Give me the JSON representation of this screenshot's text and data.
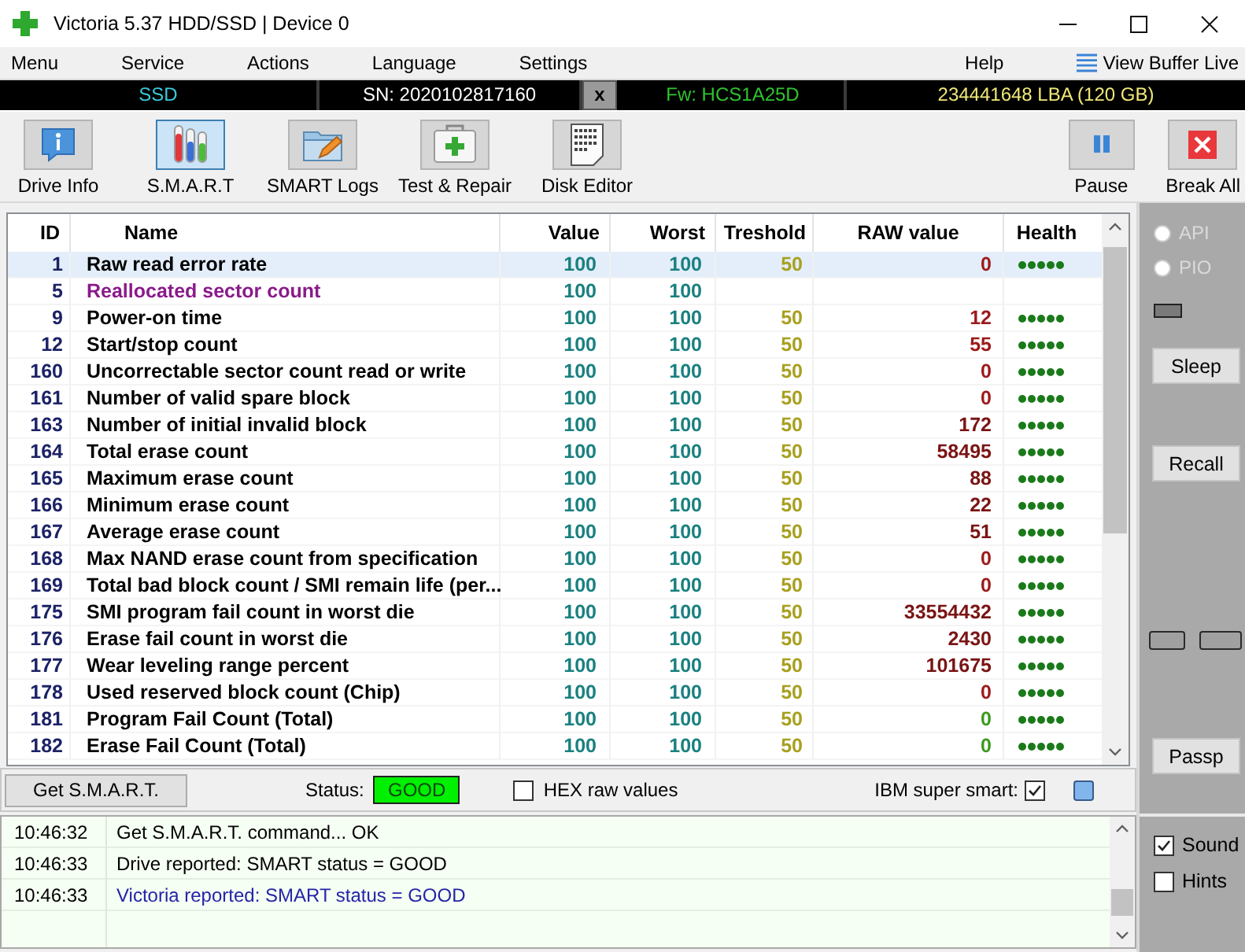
{
  "window": {
    "title": "Victoria 5.37 HDD/SSD | Device 0"
  },
  "menu": {
    "items": [
      "Menu",
      "Service",
      "Actions",
      "Language",
      "Settings"
    ],
    "help": "Help",
    "view_buffer": "View Buffer Live"
  },
  "info_bar": {
    "drive_type": "SSD",
    "serial": "SN: 2020102817160",
    "close": "x",
    "firmware": "Fw: HCS1A25D",
    "capacity": "234441648 LBA (120 GB)"
  },
  "toolbar": {
    "tools": [
      {
        "label": "Drive Info",
        "kind": "info",
        "selected": false
      },
      {
        "label": "S.M.A.R.T",
        "kind": "smart",
        "selected": true
      },
      {
        "label": "SMART Logs",
        "kind": "logs",
        "selected": false
      },
      {
        "label": "Test & Repair",
        "kind": "repair",
        "selected": false
      },
      {
        "label": "Disk Editor",
        "kind": "editor",
        "selected": false
      }
    ],
    "actions": [
      {
        "label": "Pause",
        "kind": "pause"
      },
      {
        "label": "Break All",
        "kind": "stop"
      }
    ]
  },
  "table": {
    "columns": [
      "ID",
      "Name",
      "Value",
      "Worst",
      "Treshold",
      "RAW value",
      "Health"
    ],
    "rows": [
      {
        "id": "1",
        "name": "Raw read error rate",
        "flagged": false,
        "value": "100",
        "worst": "100",
        "threshold": "50",
        "raw": {
          "text": "0",
          "color": "#9c1a1a"
        },
        "stars": 5,
        "selected": true
      },
      {
        "id": "5",
        "name": "Reallocated sector count",
        "flagged": true,
        "value": "100",
        "worst": "100",
        "selected": false
      },
      {
        "id": "9",
        "name": "Power-on time",
        "flagged": false,
        "value": "100",
        "worst": "100",
        "threshold": "50",
        "raw": {
          "text": "12",
          "color": "#9c1a1a"
        },
        "stars": 5,
        "selected": false
      },
      {
        "id": "12",
        "name": "Start/stop count",
        "flagged": false,
        "value": "100",
        "worst": "100",
        "threshold": "50",
        "raw": {
          "text": "55",
          "color": "#9c1a1a"
        },
        "stars": 5,
        "selected": false
      },
      {
        "id": "160",
        "name": "Uncorrectable sector count read or write",
        "flagged": false,
        "value": "100",
        "worst": "100",
        "threshold": "50",
        "raw": {
          "text": "0",
          "color": "#9c1a1a"
        },
        "stars": 5,
        "selected": false
      },
      {
        "id": "161",
        "name": "Number of valid spare block",
        "flagged": false,
        "value": "100",
        "worst": "100",
        "threshold": "50",
        "raw": {
          "text": "0",
          "color": "#9c1a1a"
        },
        "stars": 5,
        "selected": false
      },
      {
        "id": "163",
        "name": "Number of initial invalid block",
        "flagged": false,
        "value": "100",
        "worst": "100",
        "threshold": "50",
        "raw": {
          "text": "172",
          "color": "#7a1414"
        },
        "stars": 5,
        "selected": false
      },
      {
        "id": "164",
        "name": "Total erase count",
        "flagged": false,
        "value": "100",
        "worst": "100",
        "threshold": "50",
        "raw": {
          "text": "58495",
          "color": "#7a1414"
        },
        "stars": 5,
        "selected": false
      },
      {
        "id": "165",
        "name": "Maximum erase count",
        "flagged": false,
        "value": "100",
        "worst": "100",
        "threshold": "50",
        "raw": {
          "text": "88",
          "color": "#7a1414"
        },
        "stars": 5,
        "selected": false
      },
      {
        "id": "166",
        "name": "Minimum erase count",
        "flagged": false,
        "value": "100",
        "worst": "100",
        "threshold": "50",
        "raw": {
          "text": "22",
          "color": "#7a1414"
        },
        "stars": 5,
        "selected": false
      },
      {
        "id": "167",
        "name": "Average erase count",
        "flagged": false,
        "value": "100",
        "worst": "100",
        "threshold": "50",
        "raw": {
          "text": "51",
          "color": "#7a1414"
        },
        "stars": 5,
        "selected": false
      },
      {
        "id": "168",
        "name": "Max NAND erase count from specification",
        "flagged": false,
        "value": "100",
        "worst": "100",
        "threshold": "50",
        "raw": {
          "text": "0",
          "color": "#9c1a1a"
        },
        "stars": 5,
        "selected": false
      },
      {
        "id": "169",
        "name": "Total bad block count / SMI remain life (per...",
        "flagged": false,
        "value": "100",
        "worst": "100",
        "threshold": "50",
        "raw": {
          "text": "0",
          "color": "#9c1a1a"
        },
        "stars": 5,
        "selected": false
      },
      {
        "id": "175",
        "name": "SMI program fail count in worst die",
        "flagged": false,
        "value": "100",
        "worst": "100",
        "threshold": "50",
        "raw": {
          "text": "33554432",
          "color": "#7a1414"
        },
        "stars": 5,
        "selected": false
      },
      {
        "id": "176",
        "name": "Erase fail count in worst die",
        "flagged": false,
        "value": "100",
        "worst": "100",
        "threshold": "50",
        "raw": {
          "text": "2430",
          "color": "#7a1414"
        },
        "stars": 5,
        "selected": false
      },
      {
        "id": "177",
        "name": "Wear leveling range percent",
        "flagged": false,
        "value": "100",
        "worst": "100",
        "threshold": "50",
        "raw": {
          "text": "101675",
          "color": "#7a1414"
        },
        "stars": 5,
        "selected": false
      },
      {
        "id": "178",
        "name": "Used reserved block count (Chip)",
        "flagged": false,
        "value": "100",
        "worst": "100",
        "threshold": "50",
        "raw": {
          "text": "0",
          "color": "#9c1a1a"
        },
        "stars": 5,
        "selected": false
      },
      {
        "id": "181",
        "name": "Program Fail Count (Total)",
        "flagged": false,
        "value": "100",
        "worst": "100",
        "threshold": "50",
        "raw": {
          "text": "0",
          "color": "#3c9a1e"
        },
        "stars": 5,
        "selected": false
      },
      {
        "id": "182",
        "name": "Erase Fail Count (Total)",
        "flagged": false,
        "value": "100",
        "worst": "100",
        "threshold": "50",
        "raw": {
          "text": "0",
          "color": "#3c9a1e"
        },
        "stars": 5,
        "selected": false
      }
    ]
  },
  "bottom_bar": {
    "button": "Get S.M.A.R.T.",
    "status_label": "Status:",
    "status": {
      "text": "GOOD",
      "ok": true
    },
    "hex": {
      "label": "HEX raw values",
      "checked": false
    },
    "ibm": {
      "label": "IBM super smart:",
      "checked": true
    },
    "swatch": {
      "color": "#80b6ec"
    }
  },
  "log": [
    {
      "time": "10:46:32",
      "message": "Get S.M.A.R.T. command... OK",
      "kind": "plain"
    },
    {
      "time": "10:46:33",
      "message": "Drive reported: SMART status = GOOD",
      "kind": "plain"
    },
    {
      "time": "10:46:33",
      "message": "Victoria reported: SMART status = GOOD",
      "kind": "accent"
    }
  ],
  "side_panel": {
    "modes": [
      {
        "label": "API",
        "selected": false,
        "disabled": true
      },
      {
        "label": "PIO",
        "selected": false,
        "disabled": true
      }
    ],
    "buttons": [
      "Sleep",
      "Recall"
    ],
    "small_buttons": [
      {
        "disabled": true
      },
      {
        "disabled": true
      }
    ],
    "passp": "Passp",
    "options": [
      {
        "label": "Sound",
        "checked": true
      },
      {
        "label": "Hints",
        "checked": false
      }
    ]
  }
}
